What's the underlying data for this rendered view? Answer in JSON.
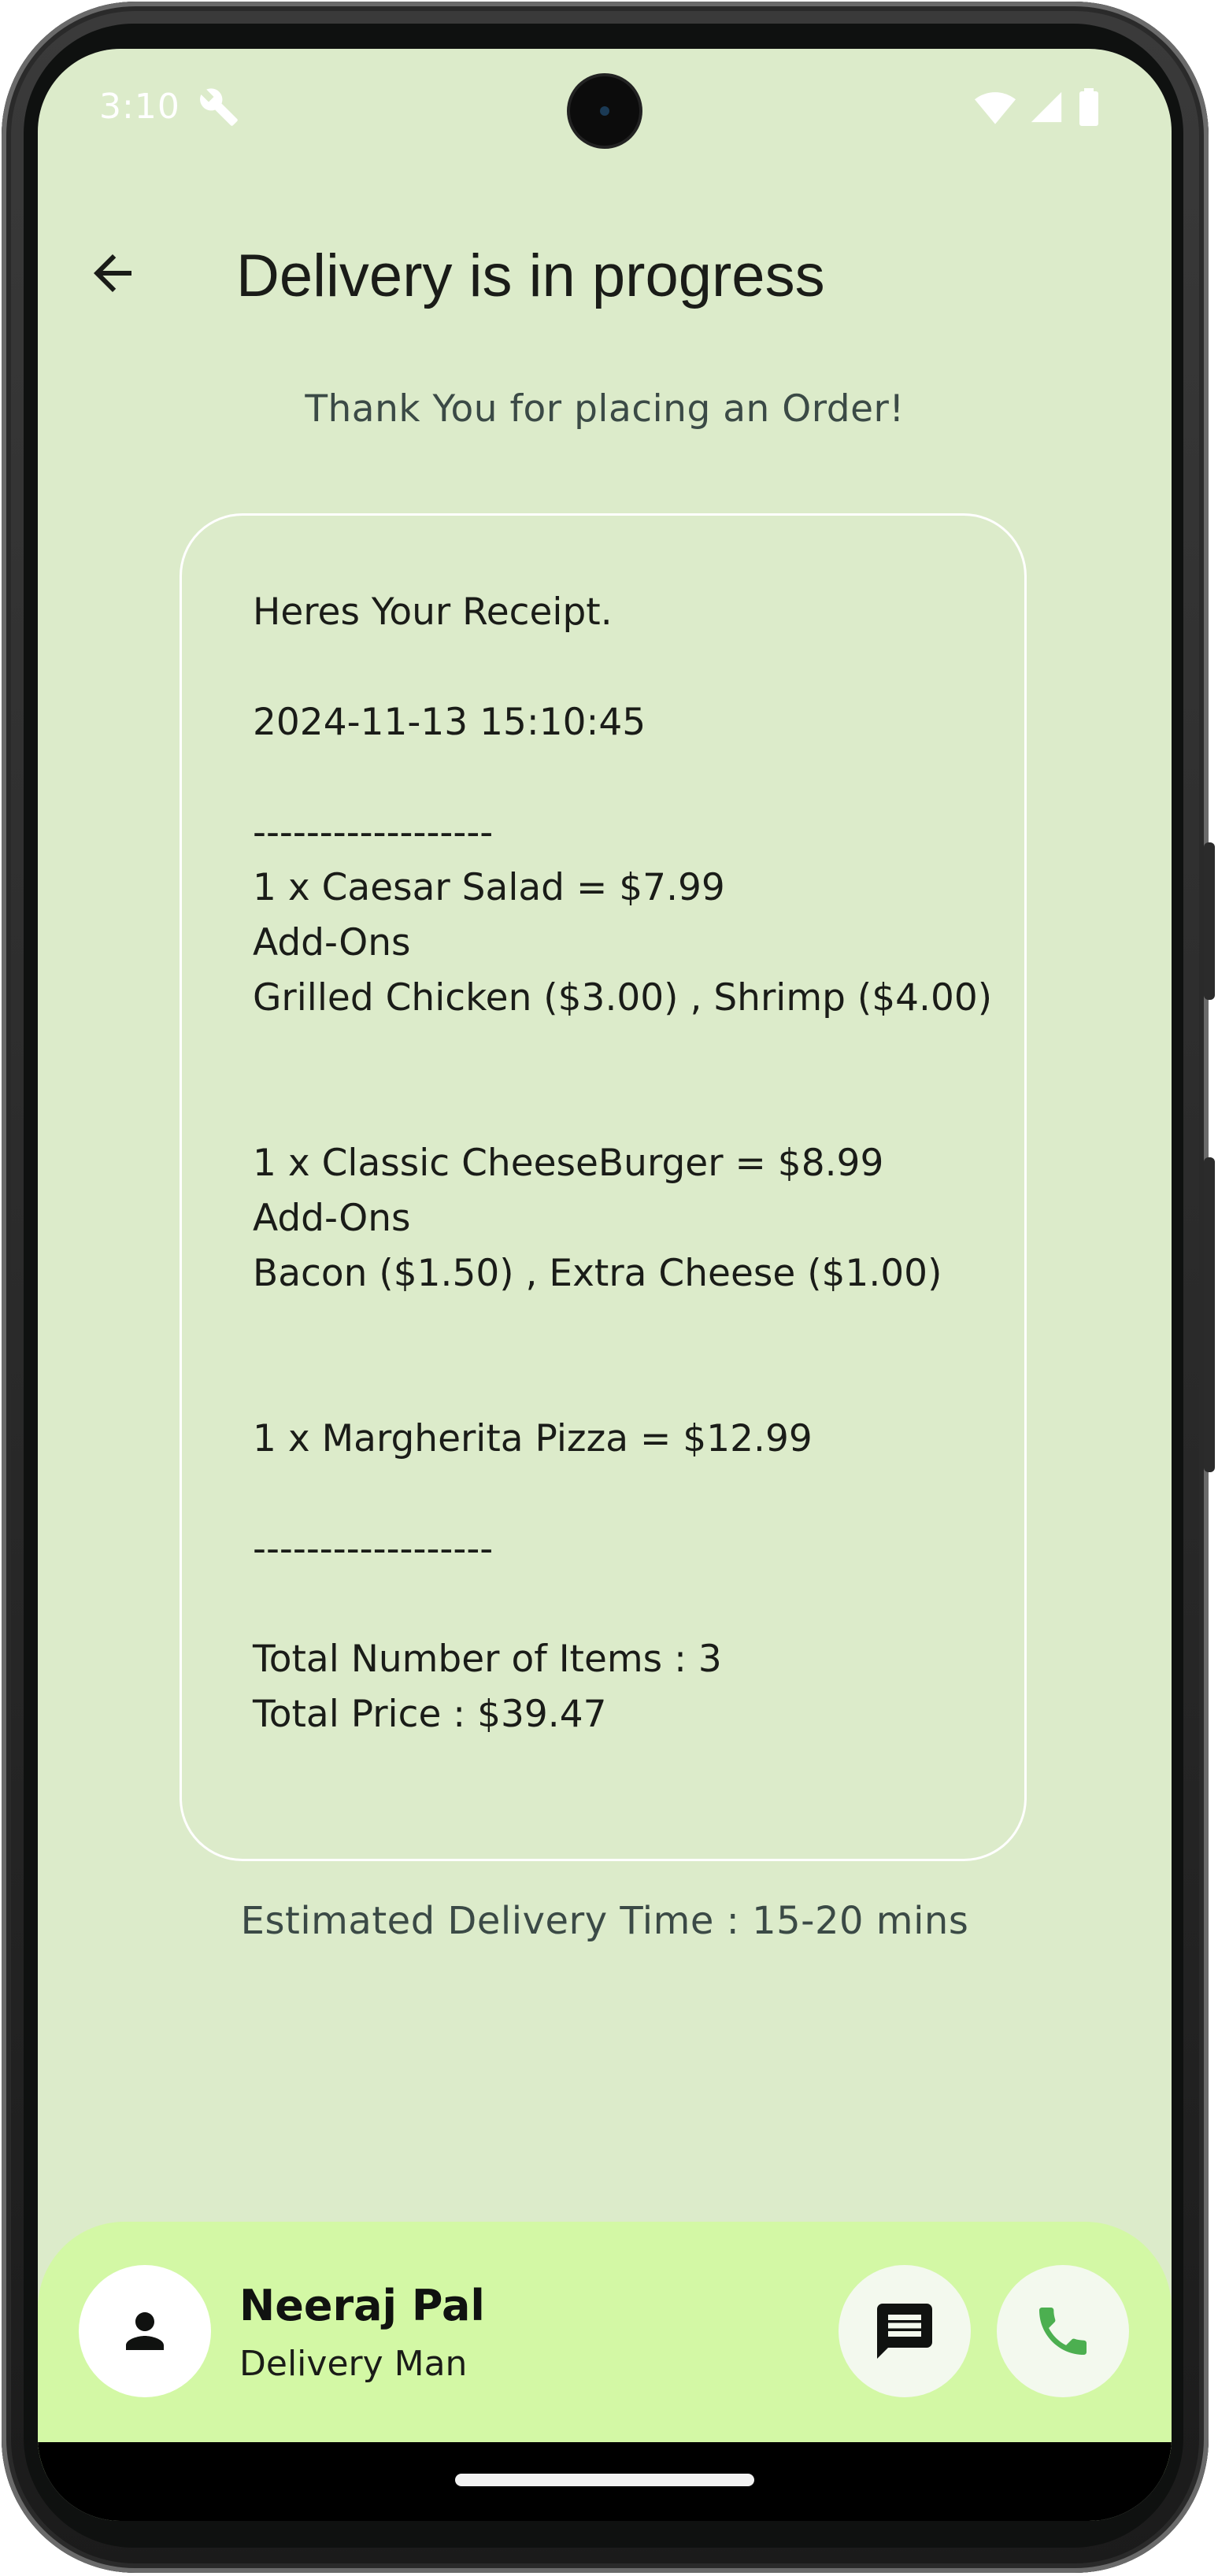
{
  "status_bar": {
    "time": "3:10",
    "icons": [
      "wrench-icon",
      "wifi-icon",
      "signal-icon",
      "battery-icon"
    ]
  },
  "app_bar": {
    "back_icon": "arrow-back-icon",
    "title": "Delivery is in progress"
  },
  "thank_you": "Thank You for placing an Order!",
  "receipt": {
    "heading": "Heres Your Receipt.",
    "timestamp": "2024-11-13 15:10:45",
    "divider_top": "------------------",
    "items": [
      {
        "line": "1 x Caesar Salad = $7.99",
        "addons_label": "Add-Ons",
        "addons": "Grilled Chicken ($3.00) , Shrimp ($4.00)"
      },
      {
        "line": "1 x Classic CheeseBurger = $8.99",
        "addons_label": "Add-Ons",
        "addons": "Bacon ($1.50) , Extra Cheese ($1.00)"
      },
      {
        "line": "1 x Margherita Pizza = $12.99"
      }
    ],
    "divider_bottom": "------------------",
    "total_items": "Total Number of Items : 3",
    "total_price": "Total Price : $39.47"
  },
  "eta": "Estimated Delivery Time : 15-20 mins",
  "driver": {
    "avatar_icon": "person-icon",
    "name": "Neeraj Pal",
    "role": "Delivery Man",
    "message_icon": "message-icon",
    "call_icon": "phone-icon"
  },
  "colors": {
    "background": "#dcebca",
    "card": "#d3f8a5",
    "accent": "#4caf50",
    "text": "#1a1c18"
  }
}
